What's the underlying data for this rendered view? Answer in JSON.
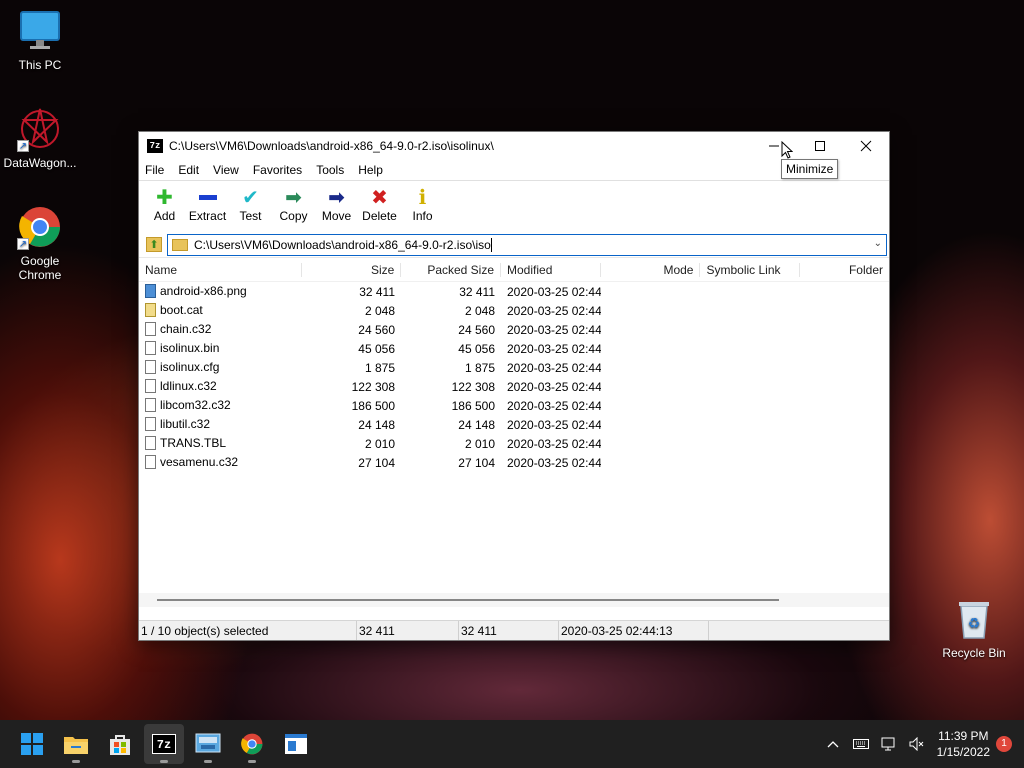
{
  "desktop": {
    "icons": [
      {
        "label": "This PC",
        "icon": "monitor-icon"
      },
      {
        "label": "DataWagon...",
        "icon": "datawagon-icon"
      },
      {
        "label": "Google Chrome",
        "icon": "chrome-icon"
      },
      {
        "label": "Recycle Bin",
        "icon": "recycle-bin-icon"
      }
    ]
  },
  "window": {
    "app_icon": "7z",
    "title": "C:\\Users\\VM6\\Downloads\\android-x86_64-9.0-r2.iso\\isolinux\\",
    "tooltip": "Minimize",
    "menu": [
      "File",
      "Edit",
      "View",
      "Favorites",
      "Tools",
      "Help"
    ],
    "toolbar": [
      {
        "label": "Add",
        "icon": "plus-icon",
        "color": "#2fb82f"
      },
      {
        "label": "Extract",
        "icon": "minus-icon",
        "color": "#1a3fd0"
      },
      {
        "label": "Test",
        "icon": "check-icon",
        "color": "#1fb8c8"
      },
      {
        "label": "Copy",
        "icon": "copy-arrow-icon",
        "color": "#2b8a5a"
      },
      {
        "label": "Move",
        "icon": "move-arrow-icon",
        "color": "#1a2a8a"
      },
      {
        "label": "Delete",
        "icon": "delete-x-icon",
        "color": "#d02020"
      },
      {
        "label": "Info",
        "icon": "info-icon",
        "color": "#d0b000"
      }
    ],
    "address": "C:\\Users\\VM6\\Downloads\\android-x86_64-9.0-r2.iso\\iso",
    "columns": [
      "Name",
      "Size",
      "Packed Size",
      "Modified",
      "Mode",
      "Symbolic Link",
      "Folder"
    ],
    "files": [
      {
        "name": "android-x86.png",
        "size": "32 411",
        "packed": "32 411",
        "modified": "2020-03-25 02:44",
        "type": "png"
      },
      {
        "name": "boot.cat",
        "size": "2 048",
        "packed": "2 048",
        "modified": "2020-03-25 02:44",
        "type": "cat"
      },
      {
        "name": "chain.c32",
        "size": "24 560",
        "packed": "24 560",
        "modified": "2020-03-25 02:44",
        "type": "file"
      },
      {
        "name": "isolinux.bin",
        "size": "45 056",
        "packed": "45 056",
        "modified": "2020-03-25 02:44",
        "type": "file"
      },
      {
        "name": "isolinux.cfg",
        "size": "1 875",
        "packed": "1 875",
        "modified": "2020-03-25 02:44",
        "type": "file"
      },
      {
        "name": "ldlinux.c32",
        "size": "122 308",
        "packed": "122 308",
        "modified": "2020-03-25 02:44",
        "type": "file"
      },
      {
        "name": "libcom32.c32",
        "size": "186 500",
        "packed": "186 500",
        "modified": "2020-03-25 02:44",
        "type": "file"
      },
      {
        "name": "libutil.c32",
        "size": "24 148",
        "packed": "24 148",
        "modified": "2020-03-25 02:44",
        "type": "file"
      },
      {
        "name": "TRANS.TBL",
        "size": "2 010",
        "packed": "2 010",
        "modified": "2020-03-25 02:44",
        "type": "file"
      },
      {
        "name": "vesamenu.c32",
        "size": "27 104",
        "packed": "27 104",
        "modified": "2020-03-25 02:44",
        "type": "file"
      }
    ],
    "status": {
      "selection": "1 / 10 object(s) selected",
      "size": "32 411",
      "packed": "32 411",
      "modified": "2020-03-25 02:44:13"
    }
  },
  "taskbar": {
    "apps": [
      "windows-start-icon",
      "file-explorer-icon",
      "store-icon",
      "7zip-icon",
      "control-panel-icon",
      "chrome-icon",
      "notepad-icon"
    ],
    "time": "11:39 PM",
    "date": "1/15/2022",
    "notifications": "1"
  }
}
